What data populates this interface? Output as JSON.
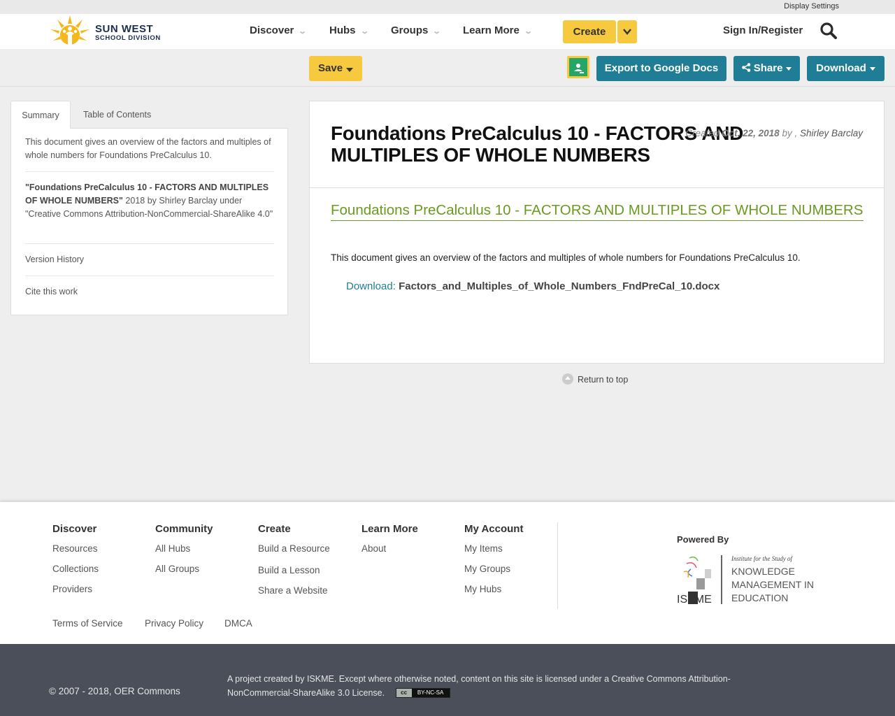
{
  "topbar": {
    "display_settings": "Display Settings"
  },
  "brand": {
    "line1": "SUN WEST",
    "line2": "SCHOOL DIVISION"
  },
  "nav": {
    "items": [
      "Discover",
      "Hubs",
      "Groups",
      "Learn More"
    ],
    "create": "Create",
    "signin": "Sign In/Register"
  },
  "toolbar": {
    "save": "Save",
    "export": "Export to Google Docs",
    "share": "Share",
    "download": "Download"
  },
  "sidebar": {
    "tabs": [
      "Summary",
      "Table of Contents"
    ],
    "summary_text": "This document gives an overview of the factors and multiples of whole numbers for Foundations PreCalculus 10.",
    "attribution_title": "\"Foundations PreCalculus 10 - FACTORS AND MULTIPLES OF WHOLE NUMBERS\"",
    "attribution_rest": " 2018 by Shirley Barclay under \"Creative Commons Attribution-NonCommercial-ShareAlike 4.0\"",
    "version_history": "Version History",
    "cite": "Cite this work"
  },
  "document": {
    "title": "Foundations PreCalculus 10 - FACTORS AND MULTIPLES OF WHOLE NUMBERS",
    "created_label": "Created",
    "created_date": "Oct. 22, 2018",
    "by_label": "by ,",
    "author": "Shirley Barclay",
    "section_title": "Foundations PreCalculus 10 - FACTORS AND MULTIPLES OF WHOLE NUMBERS",
    "description": "This document gives an overview of the factors and multiples of whole numbers for Foundations PreCalculus 10.",
    "download_label": "Download:",
    "download_file": "Factors_and_Multiples_of_Whole_Numbers_FndPreCal_10.docx",
    "return_top": "Return to top"
  },
  "footer": {
    "discover": {
      "heading": "Discover",
      "links": [
        "Resources",
        "Collections",
        "Providers"
      ]
    },
    "community": {
      "heading": "Community",
      "links": [
        "All Hubs",
        "All Groups"
      ]
    },
    "create": {
      "heading": "Create",
      "links": [
        "Build a Resource",
        "Build a Lesson",
        "Share a Website"
      ]
    },
    "learn_more": {
      "heading": "Learn More",
      "links": [
        "About"
      ]
    },
    "my_account": {
      "heading": "My Account",
      "links": [
        "My Items",
        "My Groups",
        "My Hubs"
      ]
    },
    "powered_by": "Powered By",
    "iskme": {
      "line1": "Institute for the Study of",
      "line2": "KNOWLEDGE",
      "line3": "MANAGEMENT IN",
      "line4": "EDUCATION",
      "short": "ISKME"
    },
    "legal": [
      "Terms of Service",
      "Privacy Policy",
      "DMCA"
    ],
    "copyright": "© 2007 - 2018, OER Commons",
    "project_text": "A project created by ISKME. Except where otherwise noted, content on this site is licensed under a Creative Commons Attribution-NonCommercial-ShareAlike 3.0 License.",
    "cc_badge": {
      "left": "cc",
      "right": "BY-NC-SA"
    }
  },
  "colors": {
    "accent_yellow": "#f7c93f",
    "teal": "#1f7e96",
    "green_title": "#6a9a1f",
    "footer_dark": "#4a4f59"
  }
}
